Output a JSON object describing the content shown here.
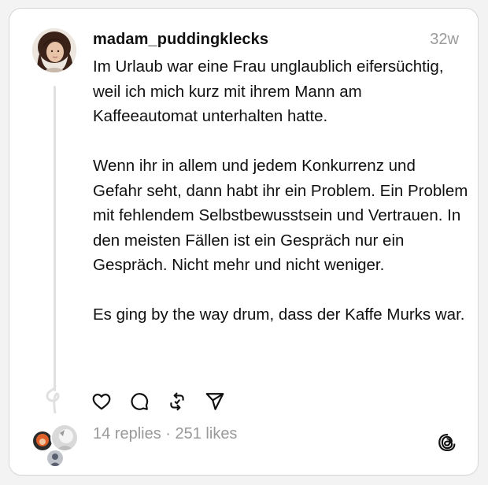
{
  "post": {
    "username": "madam_puddingklecks",
    "time": "32w",
    "paragraphs": [
      "Im Urlaub war eine Frau unglaublich eifersüchtig, weil ich mich kurz mit ihrem Mann am Kaffeeautomat unterhalten hatte.",
      "Wenn ihr in allem und jedem Konkurrenz und Gefahr seht, dann habt ihr ein Problem. Ein Problem mit fehlendem Selbstbewusstsein und Vertrauen. In den meisten Fällen ist ein Gespräch nur ein Gespräch. Nicht mehr und nicht weniger.",
      "Es ging by the way drum, dass der Kaffe Murks war."
    ]
  },
  "actions": {
    "icons": [
      "heart-icon",
      "comment-icon",
      "repost-icon",
      "share-icon"
    ]
  },
  "stats": {
    "replies": "14 replies",
    "separator": " · ",
    "likes": "251 likes"
  },
  "branding": {
    "logo": "threads-logo-icon"
  }
}
